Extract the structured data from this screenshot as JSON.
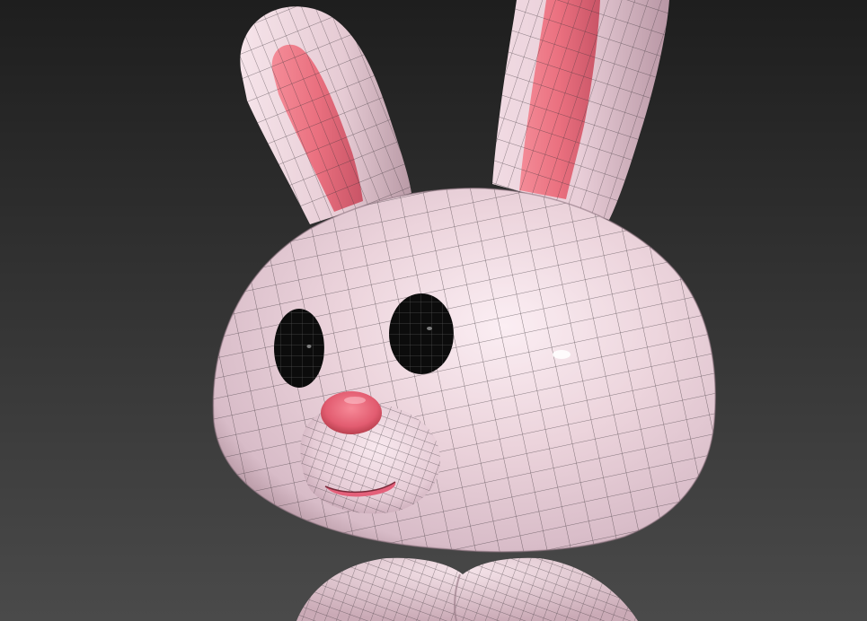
{
  "scene": {
    "subject": "bunny-3d-model",
    "render_mode": "smooth-shaded-with-wireframe-overlay",
    "colors": {
      "background_top": "#1e1e1e",
      "background_bottom": "#4a4a4a",
      "body": "#ecd4dc",
      "body_shadow": "#b89aa6",
      "inner_ear": "#e8707e",
      "eye": "#0c0c0c",
      "nose": "#e25c70",
      "mouth": "#e4607a",
      "wire": "#3a3338"
    },
    "parts": [
      "left-ear",
      "right-ear",
      "head",
      "left-eye",
      "right-eye",
      "nose",
      "mouth",
      "muzzle",
      "body"
    ]
  }
}
